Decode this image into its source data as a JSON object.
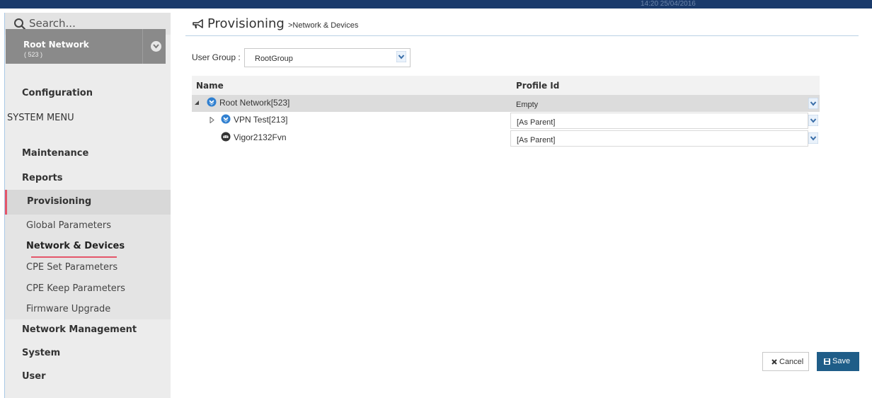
{
  "topbar": {
    "clock_text": "14:20 25/04/2016"
  },
  "sidebar": {
    "search_placeholder": "Search...",
    "network_name": "Root Network",
    "network_count": "( 523 )",
    "configuration_label": "Configuration",
    "system_menu_label": "SYSTEM MENU",
    "items": {
      "maintenance": "Maintenance",
      "reports": "Reports",
      "provisioning": "Provisioning",
      "network_management": "Network Management",
      "system": "System",
      "user": "User"
    },
    "provisioning_sub": {
      "global_parameters": "Global Parameters",
      "network_devices": "Network & Devices",
      "cpe_set_parameters": "CPE Set Parameters",
      "cpe_keep_parameters": "CPE Keep Parameters",
      "firmware_upgrade": "Firmware Upgrade"
    }
  },
  "main": {
    "title": "Provisioning",
    "breadcrumb": ">Network & Devices",
    "user_group_label": "User Group :",
    "user_group_value": "RootGroup",
    "columns": {
      "name": "Name",
      "profile_id": "Profile Id"
    },
    "rows": [
      {
        "name": "Root Network[523]",
        "profile": "Empty"
      },
      {
        "name": "VPN Test[213]",
        "profile": "[As Parent]"
      },
      {
        "name": "Vigor2132Fvn",
        "profile": "[As Parent]"
      }
    ],
    "cancel_label": "Cancel",
    "save_label": "Save"
  },
  "colors": {
    "accent_red": "#e4566a",
    "save_blue": "#1f5d88",
    "network_icon_blue": "#2f7fd0"
  }
}
